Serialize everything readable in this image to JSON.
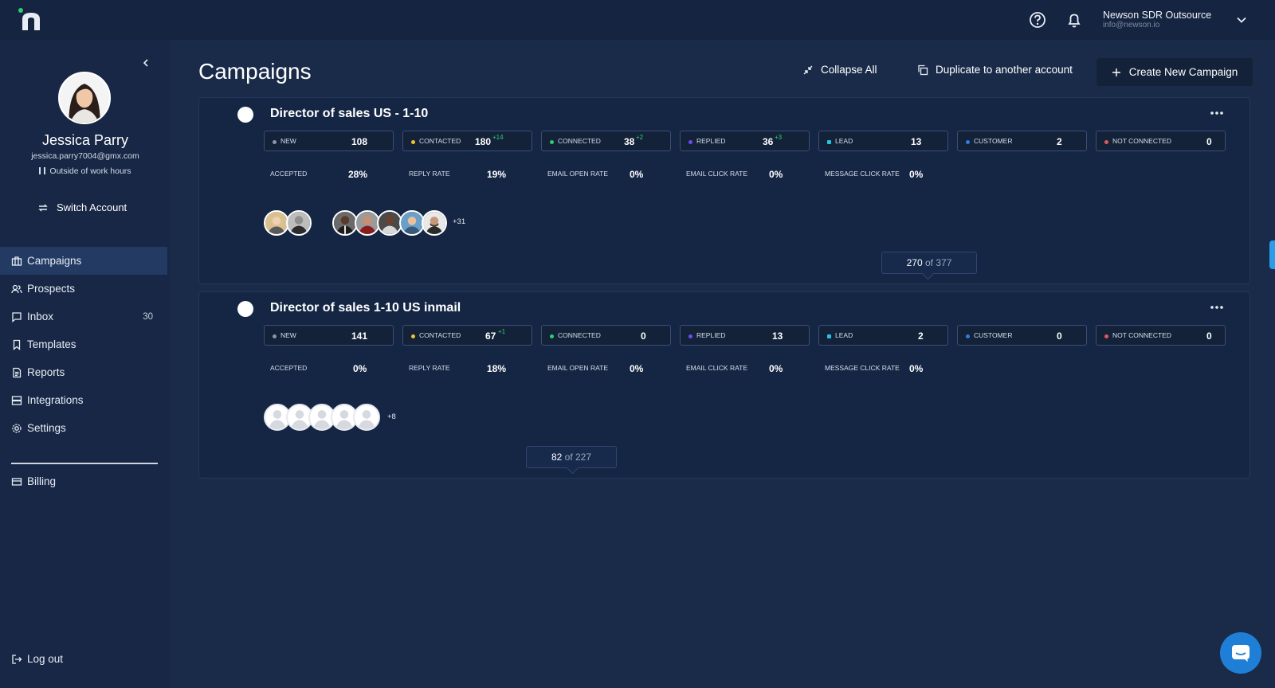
{
  "account": {
    "name": "Newson SDR Outsource",
    "email": "info@newson.io"
  },
  "user": {
    "name": "Jessica Parry",
    "email": "jessica.parry7004@gmx.com",
    "status": "Outside of work hours"
  },
  "sidebar": {
    "switch_account": "Switch Account",
    "items": [
      {
        "label": "Campaigns",
        "icon": "briefcase-icon",
        "active": true
      },
      {
        "label": "Prospects",
        "icon": "users-icon"
      },
      {
        "label": "Inbox",
        "icon": "chat-icon",
        "count": "30"
      },
      {
        "label": "Templates",
        "icon": "bookmark-icon"
      },
      {
        "label": "Reports",
        "icon": "document-icon"
      },
      {
        "label": "Integrations",
        "icon": "server-icon"
      },
      {
        "label": "Settings",
        "icon": "gear-icon"
      }
    ],
    "billing": "Billing",
    "logout": "Log out"
  },
  "header": {
    "title": "Campaigns",
    "collapse_all": "Collapse All",
    "duplicate": "Duplicate to another account",
    "create": "Create New Campaign"
  },
  "campaigns": [
    {
      "title": "Director of sales US - 1-10",
      "stages": [
        {
          "label": "NEW",
          "value": "108",
          "delta": "",
          "color": "#8a96aa"
        },
        {
          "label": "CONTACTED",
          "value": "180",
          "delta": "+14",
          "color": "#f1c232"
        },
        {
          "label": "CONNECTED",
          "value": "38",
          "delta": "+2",
          "color": "#2ecc71"
        },
        {
          "label": "REPLIED",
          "value": "36",
          "delta": "+3",
          "color": "#6b4cf0"
        },
        {
          "label": "LEAD",
          "value": "13",
          "delta": "",
          "color": "#22c3e6"
        },
        {
          "label": "CUSTOMER",
          "value": "2",
          "delta": "",
          "color": "#2f7de1"
        },
        {
          "label": "NOT CONNECTED",
          "value": "0",
          "delta": "",
          "color": "#e05a5a"
        }
      ],
      "rates": [
        {
          "label": "ACCEPTED",
          "value": "28%"
        },
        {
          "label": "REPLY RATE",
          "value": "19%"
        },
        {
          "label": "EMAIL OPEN RATE",
          "value": "0%"
        },
        {
          "label": "EMAIL CLICK RATE",
          "value": "0%"
        },
        {
          "label": "MESSAGE CLICK RATE",
          "value": "0%"
        }
      ],
      "more_avatars": "+31",
      "progress_done": "270",
      "progress_of": "of 377"
    },
    {
      "title": "Director of sales 1-10 US inmail",
      "stages": [
        {
          "label": "NEW",
          "value": "141",
          "delta": "",
          "color": "#8a96aa"
        },
        {
          "label": "CONTACTED",
          "value": "67",
          "delta": "+1",
          "color": "#f1c232"
        },
        {
          "label": "CONNECTED",
          "value": "0",
          "delta": "",
          "color": "#2ecc71"
        },
        {
          "label": "REPLIED",
          "value": "13",
          "delta": "",
          "color": "#6b4cf0"
        },
        {
          "label": "LEAD",
          "value": "2",
          "delta": "",
          "color": "#22c3e6"
        },
        {
          "label": "CUSTOMER",
          "value": "0",
          "delta": "",
          "color": "#2f7de1"
        },
        {
          "label": "NOT CONNECTED",
          "value": "0",
          "delta": "",
          "color": "#e05a5a"
        }
      ],
      "rates": [
        {
          "label": "ACCEPTED",
          "value": "0%"
        },
        {
          "label": "REPLY RATE",
          "value": "18%"
        },
        {
          "label": "EMAIL OPEN RATE",
          "value": "0%"
        },
        {
          "label": "EMAIL CLICK RATE",
          "value": "0%"
        },
        {
          "label": "MESSAGE CLICK RATE",
          "value": "0%"
        }
      ],
      "more_avatars": "+8",
      "progress_done": "82",
      "progress_of": "of 227"
    }
  ]
}
